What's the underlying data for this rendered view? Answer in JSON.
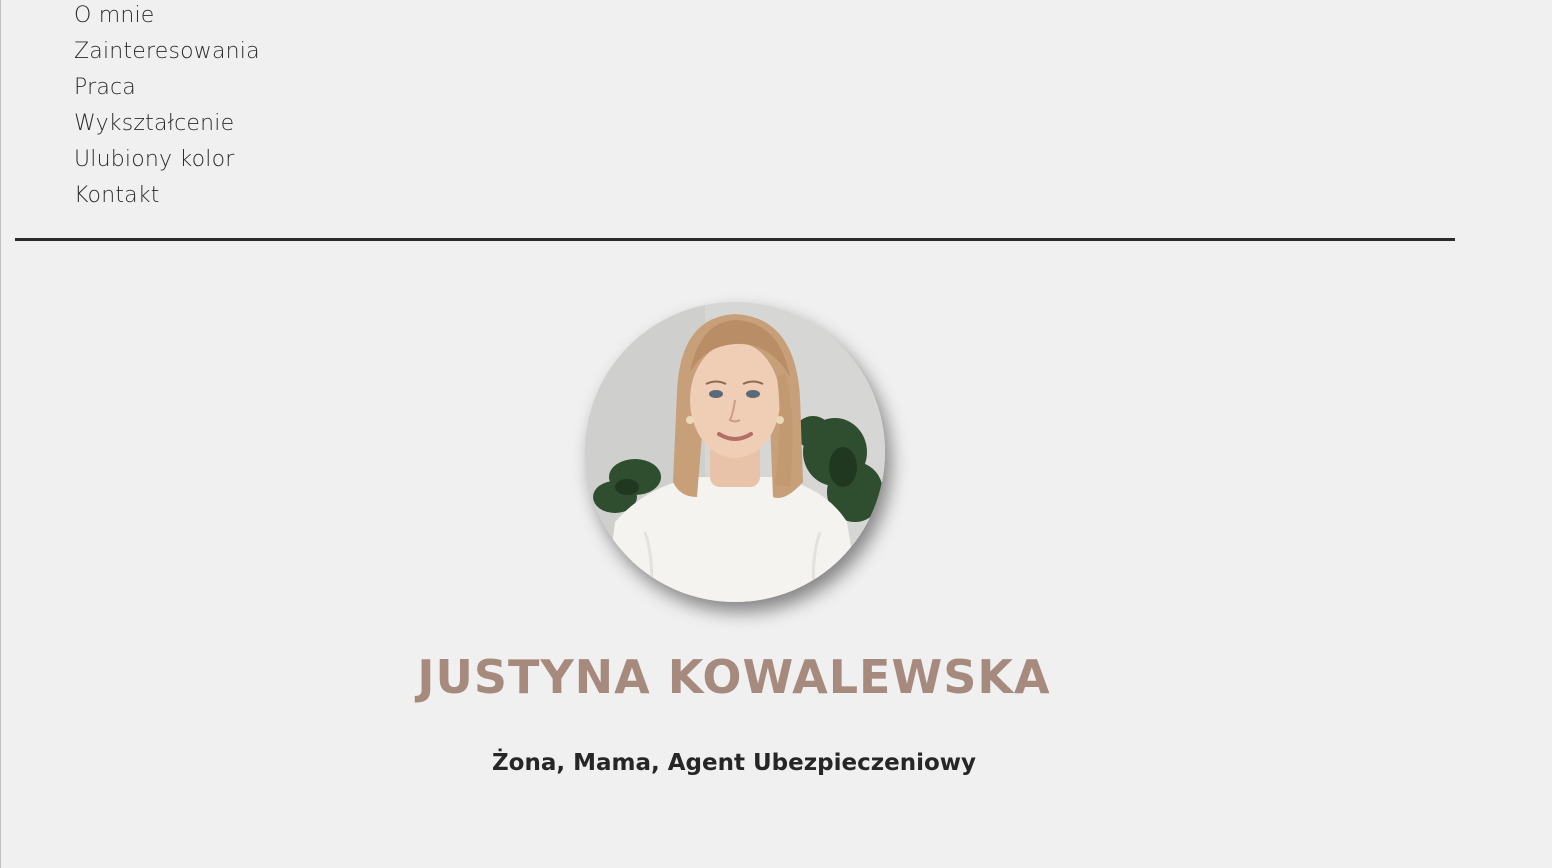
{
  "nav": {
    "items": [
      {
        "label": "O mnie"
      },
      {
        "label": "Zainteresowania"
      },
      {
        "label": "Praca"
      },
      {
        "label": "Wykształcenie"
      },
      {
        "label": "Ulubiony kolor"
      },
      {
        "label": "Kontakt"
      }
    ]
  },
  "profile": {
    "name": "JUSTYNA KOWALEWSKA",
    "tagline": "Żona, Mama, Agent Ubezpieczeniowy",
    "photo_alt": "profile-photo"
  },
  "colors": {
    "background": "#f1f0f0",
    "name": "#a68a7e",
    "text": "#2b2b2b",
    "divider": "#2b2b2b"
  }
}
